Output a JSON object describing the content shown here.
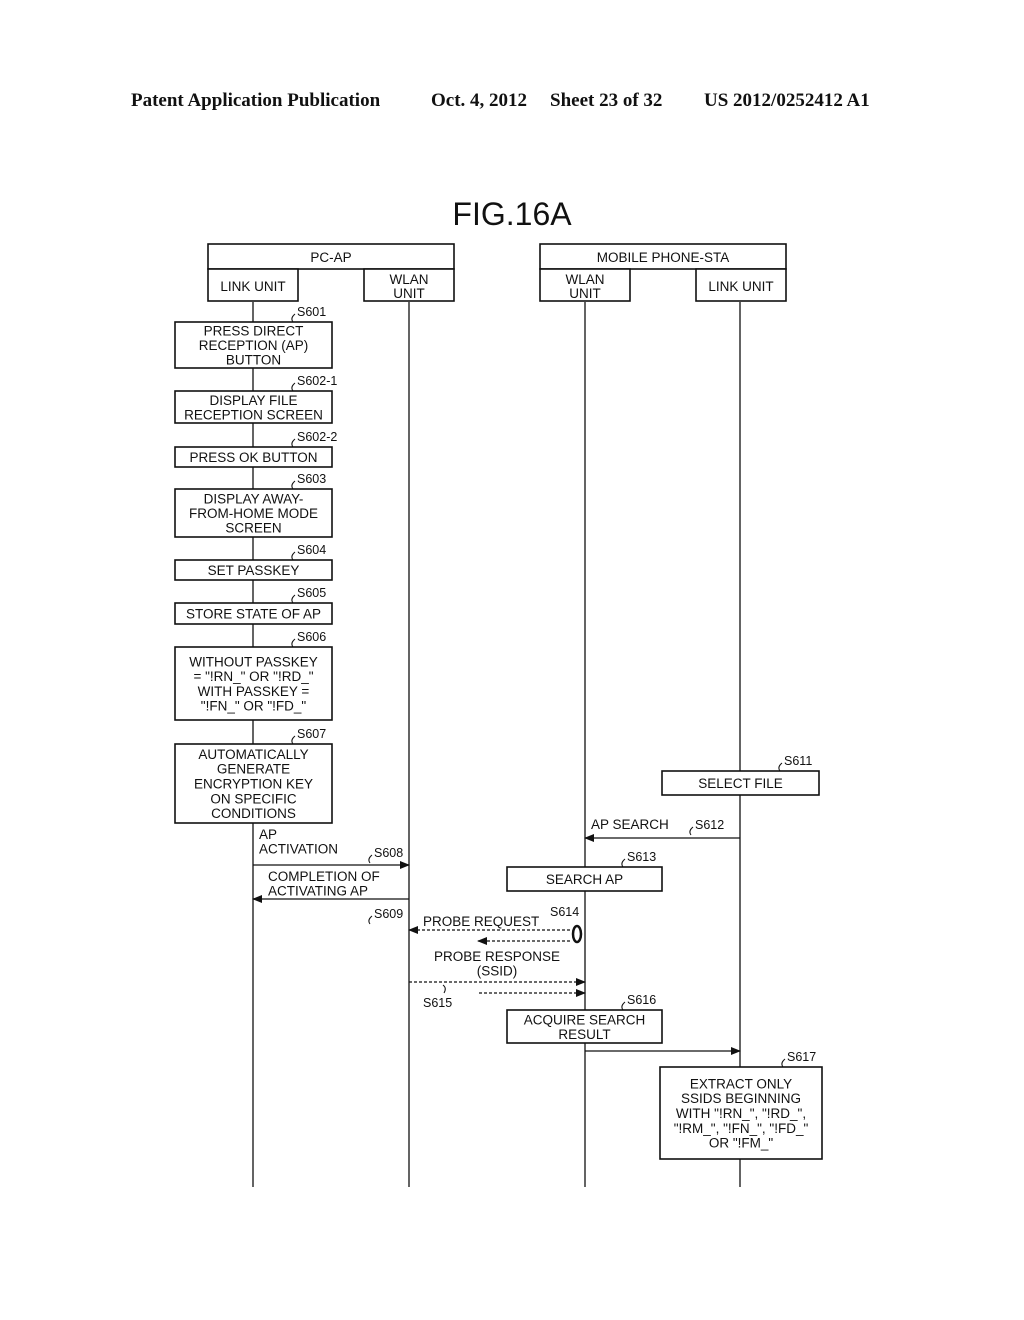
{
  "header": {
    "publication": "Patent Application Publication",
    "date": "Oct. 4, 2012",
    "sheet": "Sheet 23 of 32",
    "number": "US 2012/0252412 A1"
  },
  "figure": {
    "title": "FIG.16A"
  },
  "devices": [
    {
      "name": "PC-AP",
      "units": [
        "LINK UNIT",
        "WLAN\nUNIT"
      ]
    },
    {
      "name": "MOBILE PHONE-STA",
      "units": [
        "WLAN\nUNIT",
        "LINK UNIT"
      ]
    }
  ],
  "steps": [
    {
      "id": "S601",
      "text": [
        "PRESS DIRECT",
        "RECEPTION (AP)",
        "BUTTON"
      ]
    },
    {
      "id": "S602-1",
      "text": [
        "DISPLAY FILE",
        "RECEPTION SCREEN"
      ]
    },
    {
      "id": "S602-2",
      "text": [
        "PRESS OK BUTTON"
      ]
    },
    {
      "id": "S603",
      "text": [
        "DISPLAY AWAY-",
        "FROM-HOME MODE",
        "SCREEN"
      ]
    },
    {
      "id": "S604",
      "text": [
        "SET PASSKEY"
      ]
    },
    {
      "id": "S605",
      "text": [
        "STORE STATE OF AP"
      ]
    },
    {
      "id": "S606",
      "text": [
        "WITHOUT PASSKEY",
        "= \"!RN_\" OR \"!RD_\"",
        "WITH PASSKEY =",
        "\"!FN_\" OR \"!FD_\""
      ]
    },
    {
      "id": "S607",
      "text": [
        "AUTOMATICALLY",
        "GENERATE",
        "ENCRYPTION KEY",
        "ON SPECIFIC",
        "CONDITIONS"
      ]
    },
    {
      "id": "S611",
      "text": [
        "SELECT FILE"
      ]
    },
    {
      "id": "S613",
      "text": [
        "SEARCH AP"
      ]
    },
    {
      "id": "S616",
      "text": [
        "ACQUIRE SEARCH",
        "RESULT"
      ]
    },
    {
      "id": "S617",
      "text": [
        "EXTRACT ONLY",
        "SSIDS BEGINNING",
        "WITH \"!RN_\", \"!RD_\",",
        "\"!RM_\", \"!FN_\", \"!FD_\"",
        "OR \"!FM_\""
      ]
    }
  ],
  "messages": [
    {
      "id": "S608",
      "text": [
        "AP",
        "ACTIVATION"
      ],
      "from": "PC-AP LINK UNIT",
      "to": "PC-AP WLAN UNIT",
      "style": "solid"
    },
    {
      "id": "S609",
      "text": [
        "COMPLETION OF",
        "ACTIVATING AP"
      ],
      "from": "PC-AP WLAN UNIT",
      "to": "PC-AP LINK UNIT",
      "style": "solid"
    },
    {
      "id": "S612",
      "text": [
        "AP SEARCH"
      ],
      "from": "MOBILE LINK UNIT",
      "to": "MOBILE WLAN UNIT",
      "style": "solid"
    },
    {
      "id": "S614",
      "text": [
        "PROBE REQUEST"
      ],
      "from": "MOBILE WLAN UNIT",
      "to": "PC-AP WLAN UNIT",
      "style": "dashed"
    },
    {
      "id": "S615",
      "text": [
        "PROBE RESPONSE",
        "(SSID)"
      ],
      "from": "PC-AP WLAN UNIT",
      "to": "MOBILE WLAN UNIT",
      "style": "dashed"
    },
    {
      "id": "",
      "text": [],
      "from": "MOBILE WLAN UNIT",
      "to": "MOBILE LINK UNIT",
      "style": "solid"
    }
  ]
}
